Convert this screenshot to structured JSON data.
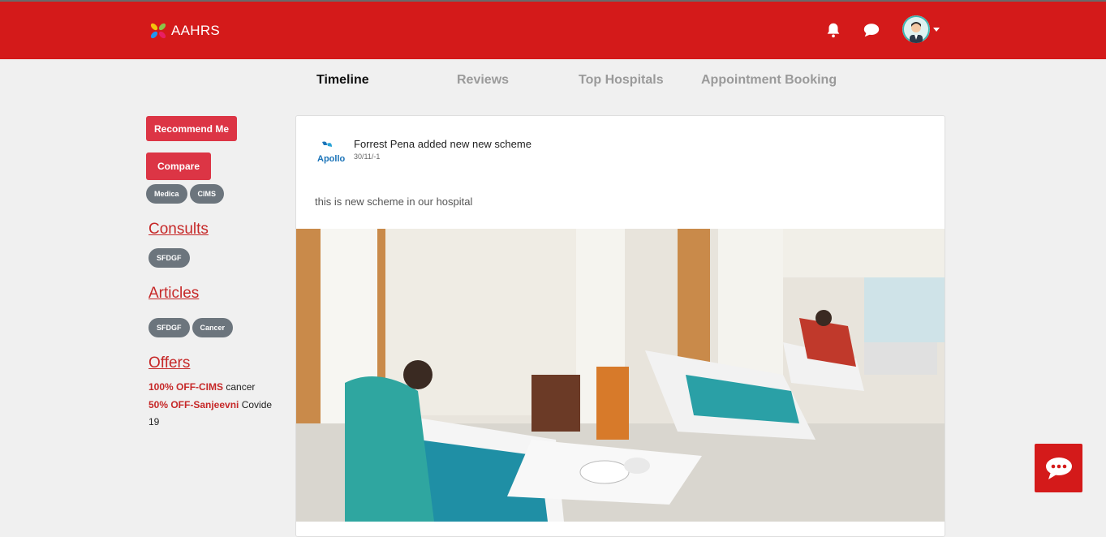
{
  "header": {
    "brand": "AAHRS",
    "icons": [
      "leaf-logo-icon",
      "bell-icon",
      "chat-bubble-icon",
      "user-avatar",
      "caret-down-icon"
    ],
    "colors": {
      "bar": "#d41a1a",
      "text": "#ffffff"
    }
  },
  "tabs": [
    {
      "label": "Timeline",
      "active": true
    },
    {
      "label": "Reviews",
      "active": false
    },
    {
      "label": "Top Hospitals",
      "active": false
    },
    {
      "label": "Appointment Booking",
      "active": false
    }
  ],
  "sidebar": {
    "recommend_label": "Recommend Me",
    "compare_label": "Compare",
    "compare_tags": [
      "Medica",
      "CIMS"
    ],
    "consults": {
      "title": "Consults",
      "tags": [
        "SFDGF"
      ]
    },
    "articles": {
      "title": "Articles",
      "tags": [
        "SFDGF",
        "Cancer"
      ]
    },
    "offers": {
      "title": "Offers",
      "items": [
        {
          "highlight": "100% OFF-CIMS",
          "text": " cancer"
        },
        {
          "highlight": "50% OFF-Sanjeevni",
          "text": " Covide 19"
        }
      ]
    }
  },
  "post": {
    "logo_text": "Apollo",
    "author_line": "Forrest Pena added new new scheme",
    "date": "30/11/-1",
    "body": "this is new scheme in our hospital"
  },
  "colors": {
    "accent": "#dc3545",
    "link": "#c62828",
    "pill": "#6c757d",
    "background": "#f0f0f0"
  }
}
